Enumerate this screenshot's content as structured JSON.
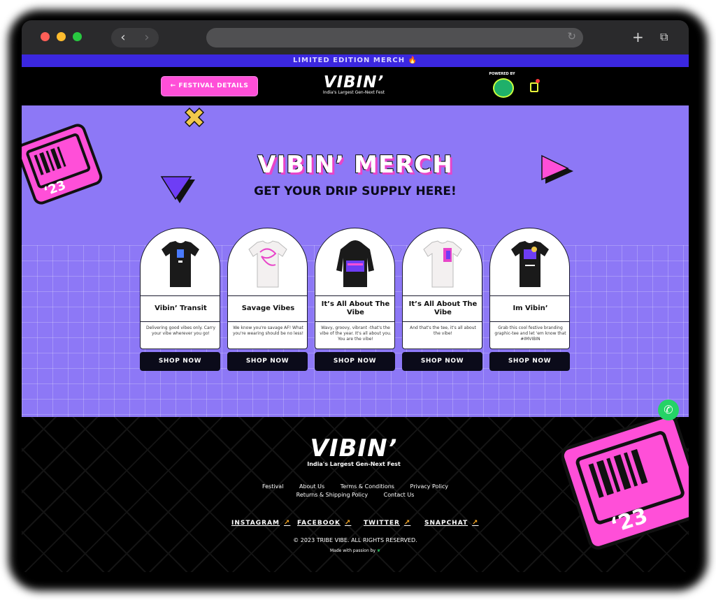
{
  "browser": {
    "reload_icon": "reload-icon",
    "back_glyph": "‹",
    "forward_glyph": "›"
  },
  "banner": {
    "text": "LIMITED EDITION MERCH 🔥"
  },
  "header": {
    "festival_button": "← FESTIVAL DETAILS",
    "logo": "VIBIN’",
    "tagline": "India's Largest Gen-Next Fest",
    "powered_by": "POWERED BY"
  },
  "hero": {
    "title": "VIBIN’ MERCH",
    "subtitle": "GET YOUR DRIP SUPPLY HERE!",
    "ticket_text": "‘23"
  },
  "products": [
    {
      "name": "Vibin’ Transit",
      "desc": "Delivering good vibes only. Carry your vibe wherever you go!",
      "cta": "SHOP NOW",
      "color": "#1a1a1a"
    },
    {
      "name": "Savage Vibes",
      "desc": "We know you're savage AF! What you're wearing should be no less!",
      "cta": "SHOP NOW",
      "color": "#f3f0f0"
    },
    {
      "name": "It’s All About The Vibe",
      "desc": "Wavy, groovy, vibrant -that's the vibe of the year. It's all about you. You are the vibe!",
      "cta": "SHOP NOW",
      "color": "#1a1a1a"
    },
    {
      "name": "It’s All About The Vibe",
      "desc": "And that's the tee, it's all about the vibe!",
      "cta": "SHOP NOW",
      "color": "#f3f0f0"
    },
    {
      "name": "Im Vibin’",
      "desc": "Grab this cool festive branding graphic-tee and let 'em know that #IMVIBIN",
      "cta": "SHOP NOW",
      "color": "#1a1a1a"
    }
  ],
  "footer": {
    "logo": "VIBIN’",
    "tagline": "India's Largest Gen-Next Fest",
    "links_row1": [
      "Festival",
      "About Us",
      "Terms & Conditions",
      "Privacy Policy"
    ],
    "links_row2": [
      "Returns & Shipping Policy",
      "Contact Us"
    ],
    "social": [
      "INSTAGRAM",
      "FACEBOOK",
      "TWITTER",
      "SNAPCHAT"
    ],
    "copyright": "© 2023 TRIBE VIBE. ALL RIGHTS RESERVED.",
    "made_with": "Made with passion by"
  },
  "colors": {
    "accent_pink": "#ff4fd8",
    "hero_purple": "#8d78f6",
    "banner_blue": "#3b27e0"
  }
}
